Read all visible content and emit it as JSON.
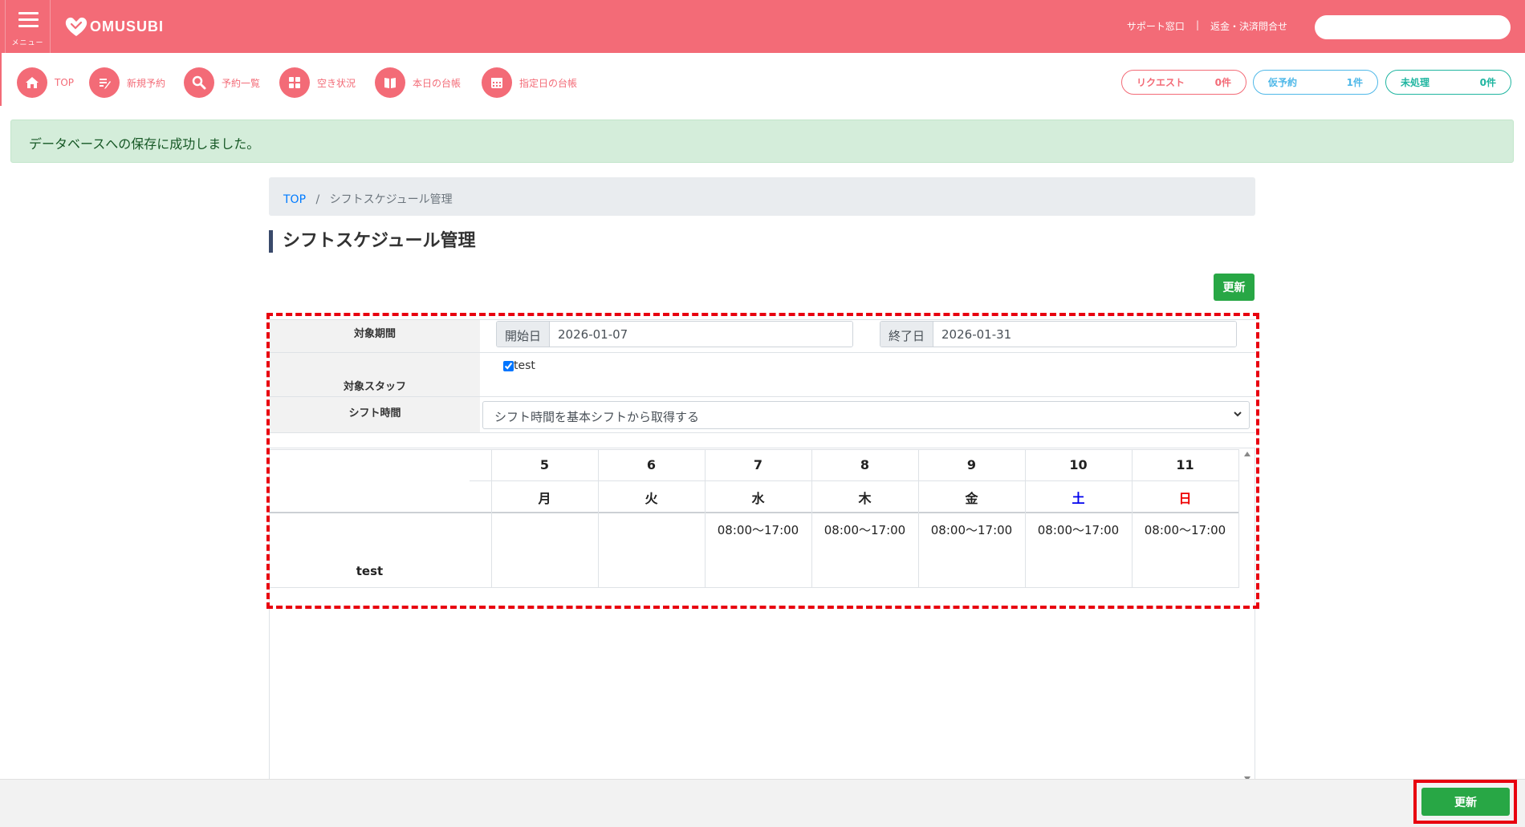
{
  "header": {
    "menu_label": "メニュー",
    "brand": "OMUSUBI",
    "support_link": "サポート窓口",
    "separator": "|",
    "refund_link": "返金・決済問合せ",
    "search_placeholder": ""
  },
  "nav": {
    "items": [
      {
        "label": "TOP",
        "icon": "home-icon"
      },
      {
        "label": "新規予約",
        "icon": "edit-icon"
      },
      {
        "label": "予約一覧",
        "icon": "search-icon"
      },
      {
        "label": "空き状況",
        "icon": "grid-icon"
      },
      {
        "label": "本日の台帳",
        "icon": "book-icon"
      },
      {
        "label": "指定日の台帳",
        "icon": "calendar-icon"
      }
    ],
    "pills": [
      {
        "label": "リクエスト",
        "count": "0件",
        "color": "#f36b77"
      },
      {
        "label": "仮予約",
        "count": "1件",
        "color": "#4fb8e8"
      },
      {
        "label": "未処理",
        "count": "0件",
        "color": "#1fb5a0"
      }
    ]
  },
  "alert": {
    "message": "データベースへの保存に成功しました。"
  },
  "breadcrumb": {
    "home": "TOP",
    "separator": "/",
    "current": "シフトスケジュール管理"
  },
  "page": {
    "title": "シフトスケジュール管理",
    "update_label": "更新"
  },
  "form": {
    "period_label": "対象期間",
    "start_prefix": "開始日",
    "start_value": "2026-01-07",
    "end_prefix": "終了日",
    "end_value": "2026-01-31",
    "staff_label": "対象スタッフ",
    "staff_name": "test",
    "staff_checked": true,
    "shift_label": "シフト時間",
    "shift_select": "シフト時間を基本シフトから取得する"
  },
  "schedule": {
    "days": [
      {
        "day": "5",
        "weekday": "月",
        "color": "#222222"
      },
      {
        "day": "6",
        "weekday": "火",
        "color": "#222222"
      },
      {
        "day": "7",
        "weekday": "水",
        "color": "#222222"
      },
      {
        "day": "8",
        "weekday": "木",
        "color": "#222222"
      },
      {
        "day": "9",
        "weekday": "金",
        "color": "#222222"
      },
      {
        "day": "10",
        "weekday": "土",
        "color": "#0000ee"
      },
      {
        "day": "11",
        "weekday": "日",
        "color": "#ee0000"
      }
    ],
    "staff_row": {
      "name": "test",
      "shifts": [
        "",
        "",
        "08:00〜17:00",
        "08:00〜17:00",
        "08:00〜17:00",
        "08:00〜17:00",
        "08:00〜17:00"
      ]
    }
  },
  "footer": {
    "update_label": "更新"
  },
  "colors": {
    "brand": "#f36b77",
    "success": "#28a745",
    "highlight": "#e8000f"
  }
}
